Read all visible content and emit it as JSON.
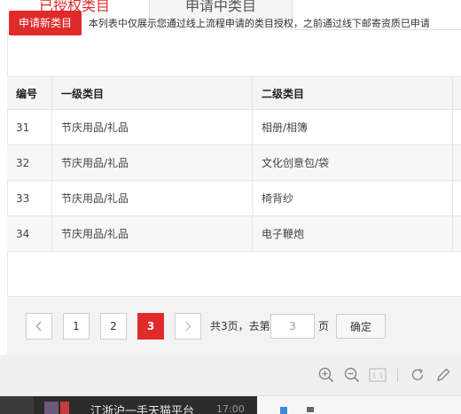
{
  "tabs": {
    "authorized": "已授权类目",
    "applying": "申请中类目"
  },
  "toolbar": {
    "apply_button": "申请新类目",
    "notice": "本列表中仅展示您通过线上流程申请的类目授权，之前通过线下邮寄资质已申请"
  },
  "table": {
    "headers": [
      "编号",
      "一级类目",
      "二级类目"
    ],
    "rows": [
      {
        "id": "31",
        "level1": "节庆用品/礼品",
        "level2": "相册/相簿"
      },
      {
        "id": "32",
        "level1": "节庆用品/礼品",
        "level2": "文化创意包/袋"
      },
      {
        "id": "33",
        "level1": "节庆用品/礼品",
        "level2": "椅背纱"
      },
      {
        "id": "34",
        "level1": "节庆用品/礼品",
        "level2": "电子鞭炮"
      }
    ]
  },
  "pagination": {
    "pages": [
      "1",
      "2",
      "3"
    ],
    "current": "3",
    "total_text": "共3页，去第",
    "goto_value": "3",
    "page_suffix": "页",
    "confirm": "确定"
  },
  "viewer": {
    "icons": [
      "zoom-in-icon",
      "zoom-out-icon",
      "actual-size-icon",
      "rotate-icon",
      "edit-icon"
    ],
    "actual_size_label": "1:1"
  },
  "taskbar": {
    "title": "江浙沪一手天猫平台",
    "time": "17:00"
  }
}
